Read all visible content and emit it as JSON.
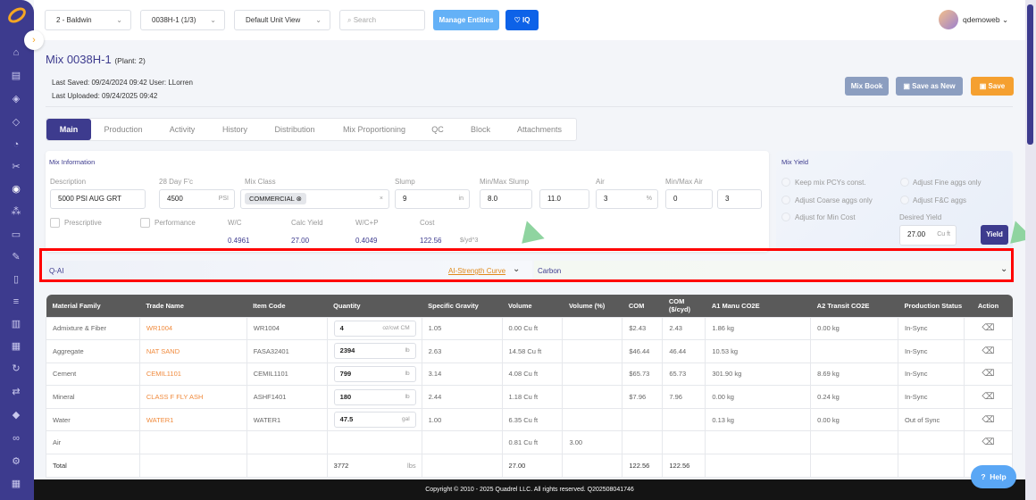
{
  "topbar": {
    "plant": "2 - Baldwin",
    "mix": "0038H-1 (1/3)",
    "unit_view": "Default Unit View",
    "search_placeholder": "Search",
    "manage_entities": "Manage Entities",
    "iq": "IQ",
    "user": "qdemoweb"
  },
  "header": {
    "title": "Mix 0038H-1",
    "plant": "(Plant: 2)",
    "last_saved": "Last Saved: 09/24/2024 09:42 User: LLorren",
    "last_uploaded": "Last Uploaded: 09/24/2025 09:42",
    "mix_book": "Mix Book",
    "save_as_new": "Save as New",
    "save": "Save"
  },
  "tabs": [
    "Main",
    "Production",
    "Activity",
    "History",
    "Distribution",
    "Mix Proportioning",
    "QC",
    "Block",
    "Attachments"
  ],
  "mix_info": {
    "title": "Mix Information",
    "description_label": "Description",
    "description": "5000 PSI AUG GRT",
    "fc_label": "28 Day F'c",
    "fc": "4500",
    "fc_unit": "PSI",
    "class_label": "Mix Class",
    "class": "COMMERCIAL",
    "slump_label": "Slump",
    "slump": "9",
    "slump_unit": "in",
    "minmax_slump_label": "Min/Max Slump",
    "slump_min": "8.0",
    "slump_max": "11.0",
    "air_label": "Air",
    "air": "3",
    "air_unit": "%",
    "minmax_air_label": "Min/Max Air",
    "air_min": "0",
    "air_max": "3",
    "prescriptive": "Prescriptive",
    "performance": "Performance",
    "wc_label": "W/C",
    "wc": "0.4961",
    "calc_yield_label": "Calc Yield",
    "calc_yield": "27.00",
    "wcp_label": "W/C+P",
    "wcp": "0.4049",
    "cost_label": "Cost",
    "cost": "122.56",
    "cost_unit": "$/yd^3"
  },
  "mix_yield": {
    "title": "Mix Yield",
    "opt1": "Keep mix PCYs const.",
    "opt2": "Adjust Fine aggs only",
    "opt3": "Adjust Coarse aggs only",
    "opt4": "Adjust F&C aggs",
    "opt5": "Adjust for Min Cost",
    "desired_label": "Desired Yield",
    "desired": "27.00",
    "desired_unit": "Cu ft",
    "yield_btn": "Yield"
  },
  "qai": {
    "label": "Q-AI",
    "link": "AI-Strength Curve",
    "carbon": "Carbon"
  },
  "table": {
    "headers": [
      "Material Family",
      "Trade Name",
      "Item Code",
      "Quantity",
      "Specific Gravity",
      "Volume",
      "Volume (%)",
      "COM",
      "COM ($/cyd)",
      "A1 Manu CO2E",
      "A2 Transit CO2E",
      "Production Status",
      "Action"
    ],
    "rows": [
      [
        "Admixture & Fiber",
        "WR1004",
        "WR1004",
        "4",
        "oz/cwt CM",
        "1.05",
        "0.00 Cu ft",
        "",
        "$2.43",
        "2.43",
        "1.86 kg",
        "0.00 kg",
        "In-Sync"
      ],
      [
        "Aggregate",
        "NAT SAND",
        "FASA32401",
        "2394",
        "lb",
        "2.63",
        "14.58 Cu ft",
        "",
        "$46.44",
        "46.44",
        "10.53 kg",
        "",
        "In-Sync"
      ],
      [
        "Cement",
        "CEMIL1101",
        "CEMIL1101",
        "799",
        "lb",
        "3.14",
        "4.08 Cu ft",
        "",
        "$65.73",
        "65.73",
        "301.90 kg",
        "8.69 kg",
        "In-Sync"
      ],
      [
        "Mineral",
        "CLASS F FLY ASH",
        "ASHF1401",
        "180",
        "lb",
        "2.44",
        "1.18 Cu ft",
        "",
        "$7.96",
        "7.96",
        "0.00 kg",
        "0.24 kg",
        "In-Sync"
      ],
      [
        "Water",
        "WATER1",
        "WATER1",
        "47.5",
        "gal",
        "1.00",
        "6.35 Cu ft",
        "",
        "",
        "",
        "0.13 kg",
        "0.00 kg",
        "Out of Sync"
      ],
      [
        "Air",
        "",
        "",
        "",
        "",
        "",
        "0.81 Cu ft",
        "3.00",
        "",
        "",
        "",
        "",
        ""
      ]
    ],
    "total": {
      "label": "Total",
      "quantity": "3772",
      "quantity_unit": "lbs",
      "volume": "27.00",
      "com": "122.56",
      "com_cyd": "122.56"
    }
  },
  "footer": {
    "copyright": "Copyright © 2010 - 2025 Quadrel LLC. All rights reserved. Q202508041746"
  },
  "help": "Help"
}
